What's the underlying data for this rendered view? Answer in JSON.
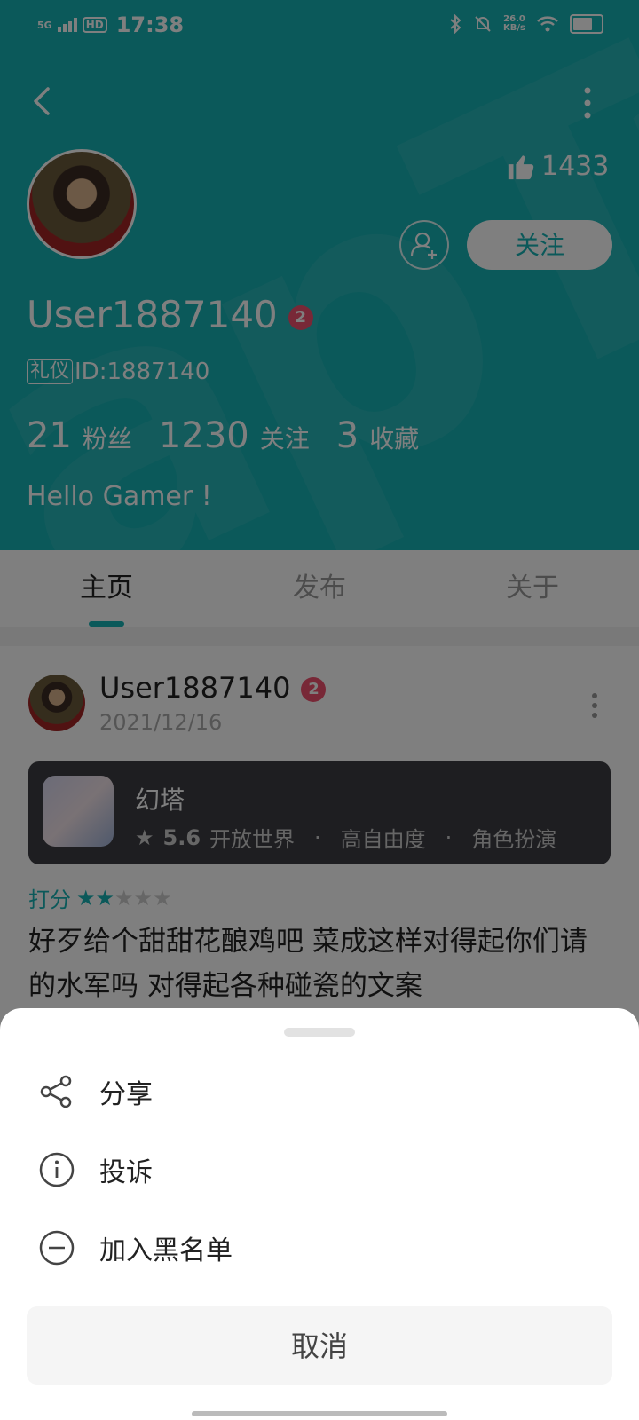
{
  "status_bar": {
    "network": "5G",
    "hd": "HD",
    "time": "17:38",
    "speed_value": "26.0",
    "speed_unit": "KB/s",
    "battery_level_percent": 62
  },
  "header": {
    "watermark": "apTa",
    "likes": "1433",
    "follow_label": "关注",
    "username": "User1887140",
    "level": "2",
    "tag": "礼仪",
    "id_text": "ID:1887140",
    "stats": [
      {
        "num": "21",
        "label": "粉丝"
      },
      {
        "num": "1230",
        "label": "关注"
      },
      {
        "num": "3",
        "label": "收藏"
      }
    ],
    "bio": "Hello Gamer !"
  },
  "tabs": [
    {
      "label": "主页",
      "active": true
    },
    {
      "label": "发布",
      "active": false
    },
    {
      "label": "关于",
      "active": false
    }
  ],
  "post": {
    "username": "User1887140",
    "level": "2",
    "date": "2021/12/16",
    "game": {
      "name": "幻塔",
      "score": "5.6",
      "tags": [
        "开放世界",
        "高自由度",
        "角色扮演"
      ]
    },
    "rating_label": "打分",
    "rating_stars": 2,
    "rating_max": 5,
    "content": "好歹给个甜甜花酿鸡吧 菜成这样对得起你们请的水军吗 对得起各种碰瓷的文案"
  },
  "sheet": {
    "items": [
      {
        "label": "分享",
        "icon": "share-icon"
      },
      {
        "label": "投诉",
        "icon": "info-icon"
      },
      {
        "label": "加入黑名单",
        "icon": "block-icon"
      }
    ],
    "cancel_label": "取消"
  },
  "colors": {
    "accent": "#16b2b4",
    "badge": "#f0506e",
    "card": "#3d3d42"
  }
}
